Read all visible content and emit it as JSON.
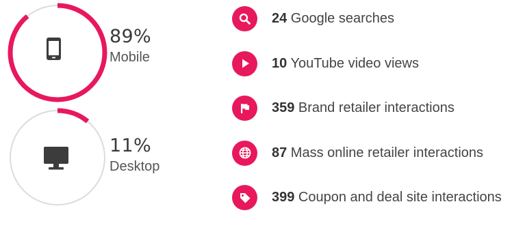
{
  "colors": {
    "accent": "#e8185c",
    "ring_track": "#dcdcdc",
    "icon": "#3c3c3c"
  },
  "devices": [
    {
      "icon": "mobile-phone-icon",
      "percent_value": 89,
      "percent": "89%",
      "label": "Mobile"
    },
    {
      "icon": "desktop-monitor-icon",
      "percent_value": 11,
      "percent": "11%",
      "label": "Desktop"
    }
  ],
  "stats": [
    {
      "icon": "search-icon",
      "number": "24",
      "text": " Google searches"
    },
    {
      "icon": "play-icon",
      "number": "10",
      "text": " YouTube video views"
    },
    {
      "icon": "flag-icon",
      "number": "359",
      "text": " Brand retailer interactions"
    },
    {
      "icon": "globe-icon",
      "number": "87",
      "text": " Mass online retailer interactions"
    },
    {
      "icon": "tag-icon",
      "number": "399",
      "text": " Coupon and deal site interactions"
    }
  ]
}
